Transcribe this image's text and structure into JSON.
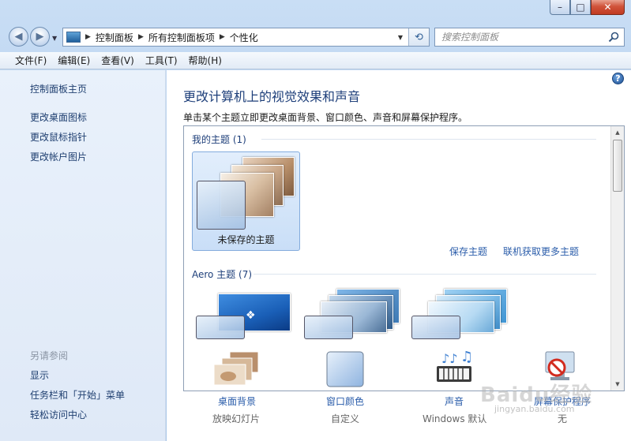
{
  "window": {
    "caption": {
      "minimize": "–",
      "maximize": "□",
      "close": "✕"
    }
  },
  "nav": {
    "back_glyph": "◀",
    "forward_glyph": "▶",
    "crumbs": [
      "控制面板",
      "所有控制面板项",
      "个性化"
    ],
    "search_placeholder": "搜索控制面板"
  },
  "menu": [
    "文件(F)",
    "编辑(E)",
    "查看(V)",
    "工具(T)",
    "帮助(H)"
  ],
  "sidebar": {
    "links": [
      "控制面板主页",
      "更改桌面图标",
      "更改鼠标指针",
      "更改帐户图片"
    ],
    "see_also_heading": "另请参阅",
    "see_also": [
      "显示",
      "任务栏和「开始」菜单",
      "轻松访问中心"
    ]
  },
  "main": {
    "title": "更改计算机上的视觉效果和声音",
    "description": "单击某个主题立即更改桌面背景、窗口颜色、声音和屏幕保护程序。",
    "help": "?",
    "my_themes_header": "我的主题 (1)",
    "my_theme_name": "未保存的主题",
    "save_theme": "保存主题",
    "get_more": "联机获取更多主题",
    "aero_header": "Aero 主题 (7)"
  },
  "bottom": [
    {
      "label": "桌面背景",
      "sub": "放映幻灯片"
    },
    {
      "label": "窗口颜色",
      "sub": "自定义"
    },
    {
      "label": "声音",
      "sub": "Windows 默认"
    },
    {
      "label": "屏幕保护程序",
      "sub": "无"
    }
  ],
  "watermark": {
    "text": "Baidu经验",
    "url": "jingyan.baidu.com"
  },
  "colors": {
    "link": "#2a5caa",
    "heading": "#1e3f7a",
    "sidebar_bg": "#e4edf9"
  }
}
